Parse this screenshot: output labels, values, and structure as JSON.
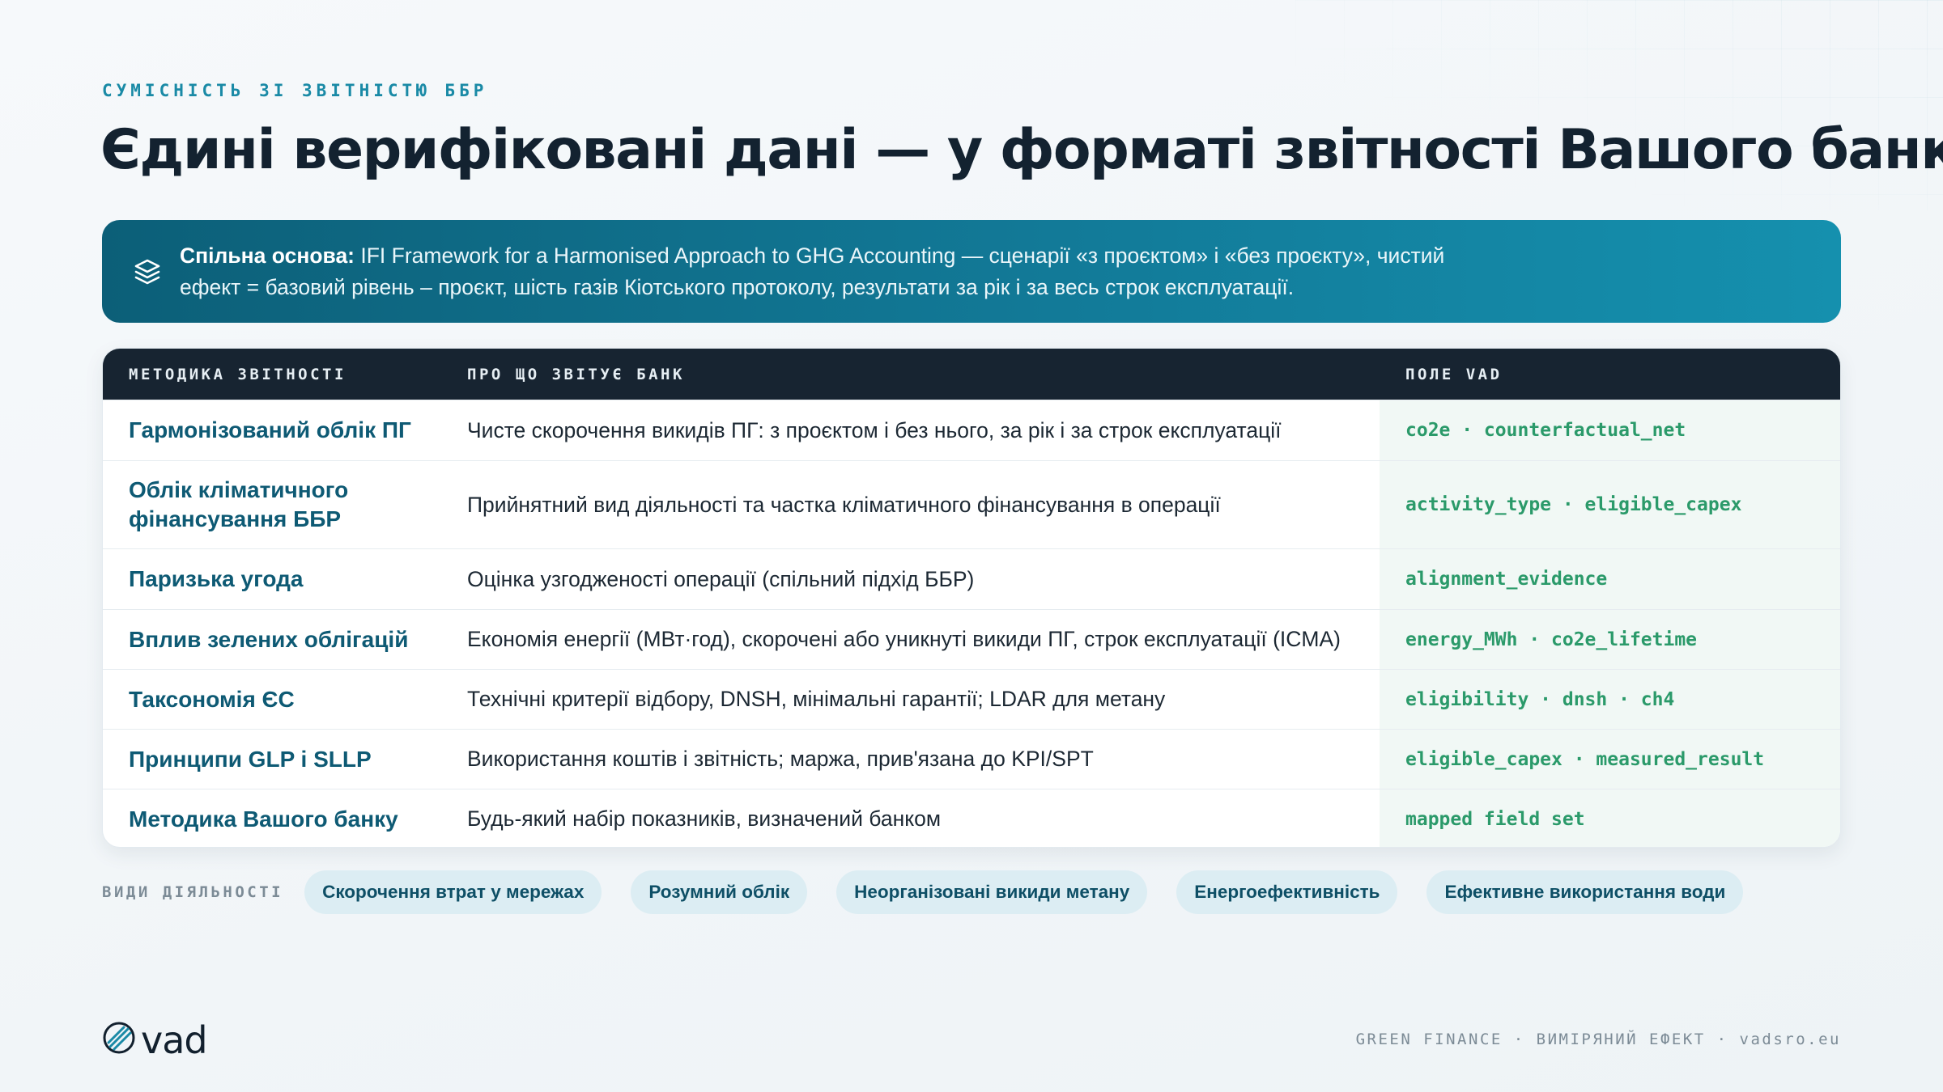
{
  "header": {
    "eyebrow": "СУМІСНІСТЬ ЗІ ЗВІТНІСТЮ ББР",
    "title": "Єдині верифіковані дані — у форматі звітності Вашого банку"
  },
  "banner": {
    "icon": "layers-icon",
    "lead": "Спільна основа:",
    "text_line1": " IFI Framework for a Harmonised Approach to GHG Accounting — сценарії «з проєктом» і «без проєкту», чистий",
    "text_line2": "ефект = базовий рівень – проєкт, шість газів Кіотського протоколу, результати за рік і за весь строк експлуатації."
  },
  "table": {
    "columns": [
      "МЕТОДИКА ЗВІТНОСТІ",
      "ПРО ЩО ЗВІТУЄ БАНК",
      "ПОЛЕ VAD"
    ],
    "rows": [
      {
        "method": "Гармонізований облік ПГ",
        "reports": "Чисте скорочення викидів ПГ: з проєктом і без нього, за рік і за строк експлуатації",
        "field": "co2e · counterfactual_net"
      },
      {
        "method": "Облік кліматичного фінансування ББР",
        "reports": "Прийнятний вид діяльності та частка кліматичного фінансування в операції",
        "field": "activity_type · eligible_capex"
      },
      {
        "method": "Паризька угода",
        "reports": "Оцінка узгодженості операції (спільний підхід ББР)",
        "field": "alignment_evidence"
      },
      {
        "method": "Вплив зелених облігацій",
        "reports": "Економія енергії (МВт·год), скорочені або уникнуті викиди ПГ, строк експлуатації (ICMA)",
        "field": "energy_MWh · co2e_lifetime"
      },
      {
        "method": "Таксономія ЄС",
        "reports": "Технічні критерії відбору, DNSH, мінімальні гарантії; LDAR для метану",
        "field": "eligibility · dnsh · ch4"
      },
      {
        "method": "Принципи GLP і SLLP",
        "reports": "Використання коштів і звітність; маржа, прив'язана до KPI/SPT",
        "field": "eligible_capex · measured_result"
      },
      {
        "method": "Методика Вашого банку",
        "reports": "Будь-який набір показників, визначений банком",
        "field": "mapped field set"
      }
    ]
  },
  "activities": {
    "label": "ВИДИ ДІЯЛЬНОСТІ",
    "chips": [
      "Скорочення втрат у мережах",
      "Розумний облік",
      "Неорганізовані викиди метану",
      "Енергоефективність",
      "Ефективне використання води"
    ]
  },
  "footer": {
    "logo_text": "vad",
    "logo_icon": "vad-logo-icon",
    "right_text": "GREEN FINANCE · ВИМІРЯНИЙ ЕФЕКТ · vadsro.eu"
  },
  "colors": {
    "accent": "#1a8aa6",
    "banner_start": "#0c5f78",
    "banner_end": "#1590ae",
    "table_header": "#172431",
    "method_text": "#0e5a74",
    "field_text": "#2b9a6a",
    "chip_bg": "#dcedf3"
  }
}
